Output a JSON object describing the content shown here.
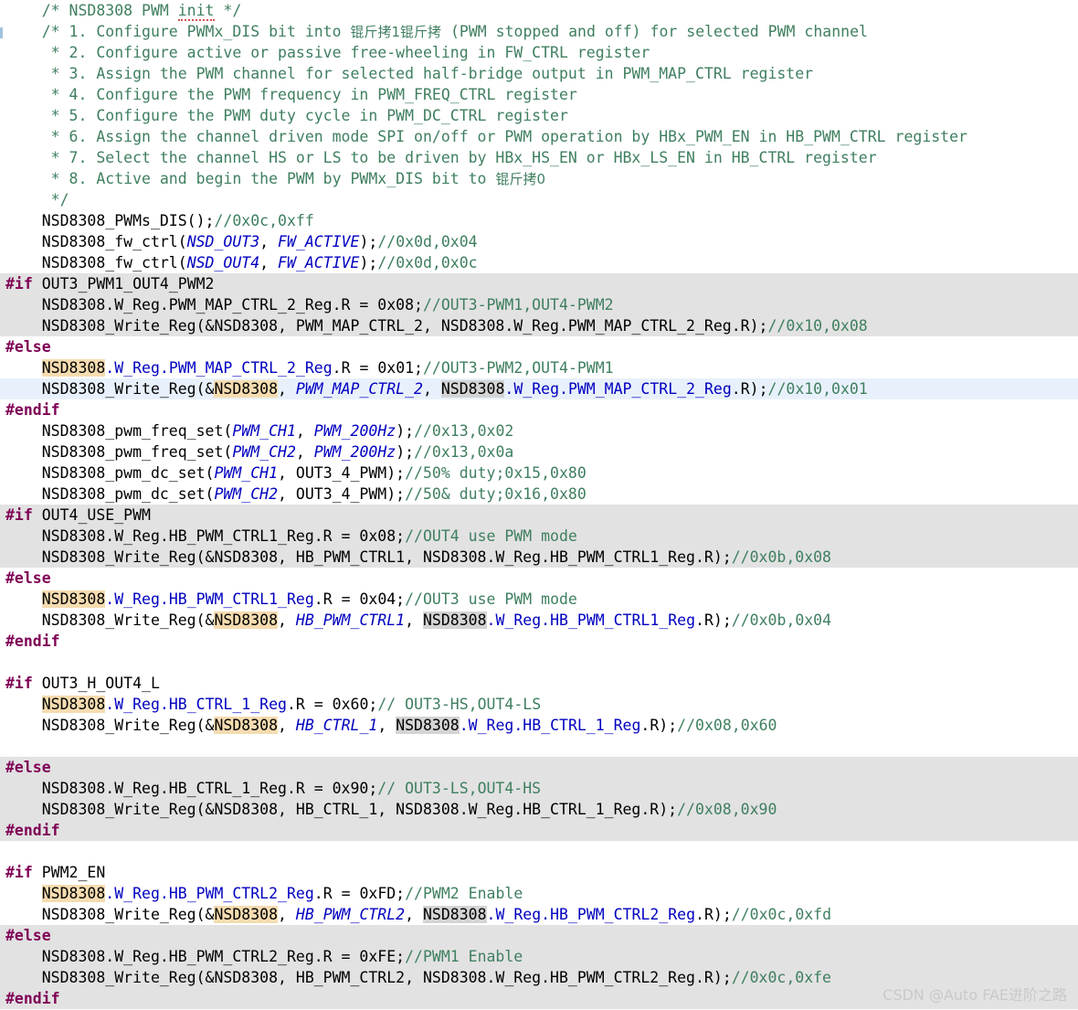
{
  "editor": {
    "title": "NSD8308 PWM init code listing",
    "language": "C",
    "colors": {
      "background": "#ffffff",
      "inactive_block": "#e2e2e2",
      "current_line": "#e8f1fb",
      "comment": "#3f7f5f",
      "preprocessor": "#7f0055",
      "macro": "#0000c0",
      "field": "#0000c0",
      "occurrence_write": "#f5dcb0",
      "occurrence_read": "#d4d4d4",
      "watermark": "#c9c9c9"
    }
  },
  "watermark": "CSDN @Auto FAE进阶之路",
  "lines": [
    {
      "n": 1,
      "text": "    /* NSD8308 PWM init */"
    },
    {
      "n": 2,
      "text": "    /* 1. Configure PWMx_DIS bit into 锟斤拷1锟斤拷 (PWM stopped and off) for selected PWM channel"
    },
    {
      "n": 3,
      "text": "     * 2. Configure active or passive free-wheeling in FW_CTRL register"
    },
    {
      "n": 4,
      "text": "     * 3. Assign the PWM channel for selected half-bridge output in PWM_MAP_CTRL register"
    },
    {
      "n": 5,
      "text": "     * 4. Configure the PWM frequency in PWM_FREQ_CTRL register"
    },
    {
      "n": 6,
      "text": "     * 5. Configure the PWM duty cycle in PWM_DC_CTRL register"
    },
    {
      "n": 7,
      "text": "     * 6. Assign the channel driven mode SPI on/off or PWM operation by HBx_PWM_EN in HB_PWM_CTRL register"
    },
    {
      "n": 8,
      "text": "     * 7. Select the channel HS or LS to be driven by HBx_HS_EN or HBx_LS_EN in HB_CTRL register"
    },
    {
      "n": 9,
      "text": "     * 8. Active and begin the PWM by PWMx_DIS bit to 锟斤拷0"
    },
    {
      "n": 10,
      "text": "     */"
    },
    {
      "n": 11,
      "text": "    NSD8308_PWMs_DIS();//0x0c,0xff"
    },
    {
      "n": 12,
      "text": "    NSD8308_fw_ctrl(NSD_OUT3, FW_ACTIVE);//0x0d,0x04"
    },
    {
      "n": 13,
      "text": "    NSD8308_fw_ctrl(NSD_OUT4, FW_ACTIVE);//0x0d,0x0c"
    },
    {
      "n": 14,
      "text": "#if OUT3_PWM1_OUT4_PWM2"
    },
    {
      "n": 15,
      "text": "    NSD8308.W_Reg.PWM_MAP_CTRL_2_Reg.R = 0x08;//OUT3-PWM1,OUT4-PWM2"
    },
    {
      "n": 16,
      "text": "    NSD8308_Write_Reg(&NSD8308, PWM_MAP_CTRL_2, NSD8308.W_Reg.PWM_MAP_CTRL_2_Reg.R);//0x10,0x08"
    },
    {
      "n": 17,
      "text": "#else"
    },
    {
      "n": 18,
      "text": "    NSD8308.W_Reg.PWM_MAP_CTRL_2_Reg.R = 0x01;//OUT3-PWM2,OUT4-PWM1"
    },
    {
      "n": 19,
      "text": "    NSD8308_Write_Reg(&NSD8308, PWM_MAP_CTRL_2, NSD8308.W_Reg.PWM_MAP_CTRL_2_Reg.R);//0x10,0x01"
    },
    {
      "n": 20,
      "text": "#endif"
    },
    {
      "n": 21,
      "text": "    NSD8308_pwm_freq_set(PWM_CH1, PWM_200Hz);//0x13,0x02"
    },
    {
      "n": 22,
      "text": "    NSD8308_pwm_freq_set(PWM_CH2, PWM_200Hz);//0x13,0x0a"
    },
    {
      "n": 23,
      "text": "    NSD8308_pwm_dc_set(PWM_CH1, OUT3_4_PWM);//50% duty;0x15,0x80"
    },
    {
      "n": 24,
      "text": "    NSD8308_pwm_dc_set(PWM_CH2, OUT3_4_PWM);//50& duty;0x16,0x80"
    },
    {
      "n": 25,
      "text": "#if OUT4_USE_PWM"
    },
    {
      "n": 26,
      "text": "    NSD8308.W_Reg.HB_PWM_CTRL1_Reg.R = 0x08;//OUT4 use PWM mode"
    },
    {
      "n": 27,
      "text": "    NSD8308_Write_Reg(&NSD8308, HB_PWM_CTRL1, NSD8308.W_Reg.HB_PWM_CTRL1_Reg.R);//0x0b,0x08"
    },
    {
      "n": 28,
      "text": "#else"
    },
    {
      "n": 29,
      "text": "    NSD8308.W_Reg.HB_PWM_CTRL1_Reg.R = 0x04;//OUT3 use PWM mode"
    },
    {
      "n": 30,
      "text": "    NSD8308_Write_Reg(&NSD8308, HB_PWM_CTRL1, NSD8308.W_Reg.HB_PWM_CTRL1_Reg.R);//0x0b,0x04"
    },
    {
      "n": 31,
      "text": "#endif"
    },
    {
      "n": 32,
      "text": ""
    },
    {
      "n": 33,
      "text": "#if OUT3_H_OUT4_L"
    },
    {
      "n": 34,
      "text": "    NSD8308.W_Reg.HB_CTRL_1_Reg.R = 0x60;// OUT3-HS,OUT4-LS"
    },
    {
      "n": 35,
      "text": "    NSD8308_Write_Reg(&NSD8308, HB_CTRL_1, NSD8308.W_Reg.HB_CTRL_1_Reg.R);//0x08,0x60"
    },
    {
      "n": 36,
      "text": ""
    },
    {
      "n": 37,
      "text": "#else"
    },
    {
      "n": 38,
      "text": "    NSD8308.W_Reg.HB_CTRL_1_Reg.R = 0x90;// OUT3-LS,OUT4-HS"
    },
    {
      "n": 39,
      "text": "    NSD8308_Write_Reg(&NSD8308, HB_CTRL_1, NSD8308.W_Reg.HB_CTRL_1_Reg.R);//0x08,0x90"
    },
    {
      "n": 40,
      "text": "#endif"
    },
    {
      "n": 41,
      "text": ""
    },
    {
      "n": 42,
      "text": "#if PWM2_EN"
    },
    {
      "n": 43,
      "text": "    NSD8308.W_Reg.HB_PWM_CTRL2_Reg.R = 0xFD;//PWM2 Enable"
    },
    {
      "n": 44,
      "text": "    NSD8308_Write_Reg(&NSD8308, HB_PWM_CTRL2, NSD8308.W_Reg.HB_PWM_CTRL2_Reg.R);//0x0c,0xfd"
    },
    {
      "n": 45,
      "text": "#else"
    },
    {
      "n": 46,
      "text": "    NSD8308.W_Reg.HB_PWM_CTRL2_Reg.R = 0xFE;//PWM1 Enable"
    },
    {
      "n": 47,
      "text": "    NSD8308_Write_Reg(&NSD8308, HB_PWM_CTRL2, NSD8308.W_Reg.HB_PWM_CTRL2_Reg.R);//0x0c,0xfe"
    },
    {
      "n": 48,
      "text": "#endif"
    }
  ]
}
